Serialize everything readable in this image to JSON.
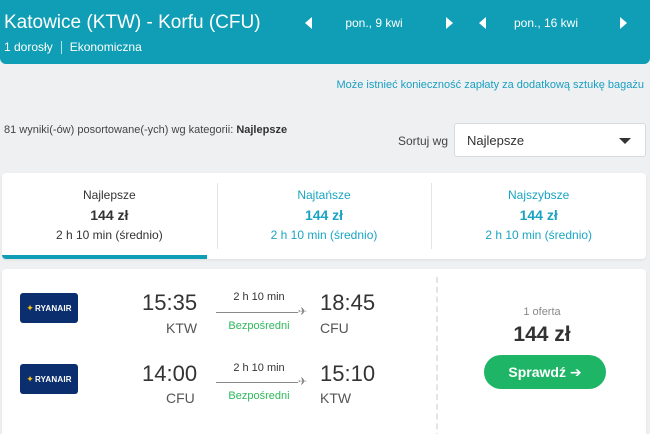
{
  "header": {
    "route": "Katowice (KTW) - Korfu (CFU)",
    "passengers": "1 dorosły",
    "cabin": "Ekonomiczna",
    "depart_date": "pon., 9 kwi",
    "return_date": "pon., 16 kwi"
  },
  "notice": "Może istnieć konieczność zapłaty za dodatkową sztukę bagażu",
  "results": {
    "count_text": "81 wyniki(-ów) posortowane(-ych) wg kategorii: ",
    "category": "Najlepsze"
  },
  "sort": {
    "label": "Sortuj wg",
    "selected": "Najlepsze"
  },
  "tabs": [
    {
      "name": "Najlepsze",
      "price": "144 zł",
      "duration": "2 h 10 min (średnio)",
      "active": true
    },
    {
      "name": "Najtańsze",
      "price": "144 zł",
      "duration": "2 h 10 min (średnio)",
      "active": false
    },
    {
      "name": "Najszybsze",
      "price": "144 zł",
      "duration": "2 h 10 min (średnio)",
      "active": false
    }
  ],
  "result": {
    "legs": [
      {
        "airline": "RYANAIR",
        "dep_time": "15:35",
        "dep_code": "KTW",
        "duration": "2 h 10 min",
        "stops": "Bezpośredni",
        "arr_time": "18:45",
        "arr_code": "CFU"
      },
      {
        "airline": "RYANAIR",
        "dep_time": "14:00",
        "dep_code": "CFU",
        "duration": "2 h 10 min",
        "stops": "Bezpośredni",
        "arr_time": "15:10",
        "arr_code": "KTW"
      }
    ],
    "offers": "1 oferta",
    "price": "144 zł",
    "cta": "Sprawdź ➔"
  },
  "colors": {
    "header": "#0f9eb5",
    "accent_link": "#1aa4c2",
    "direct": "#2eb85c",
    "cta": "#1eb566",
    "airline_logo": "#0b2f6e"
  }
}
